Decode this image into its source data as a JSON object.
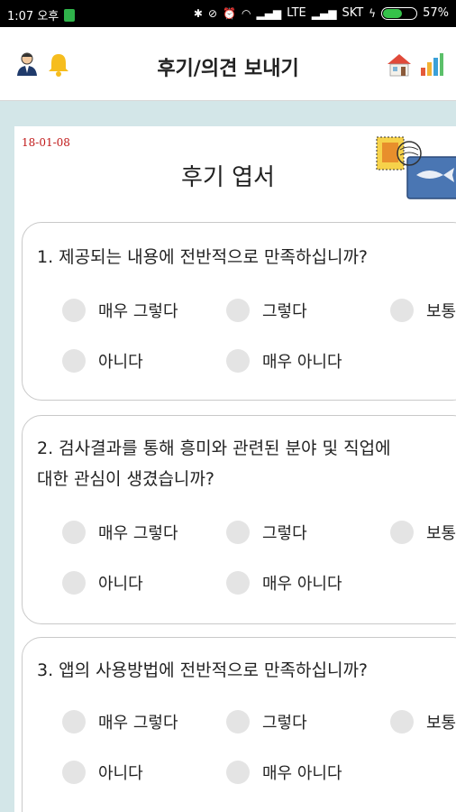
{
  "statusbar": {
    "time": "1:07 오후",
    "network": "LTE",
    "carrier": "SKT",
    "battery": "57%",
    "battery_level": 0.57
  },
  "header": {
    "title": "후기/의견 보내기",
    "icons": [
      "user-icon",
      "bell-icon",
      "home-icon",
      "chart-icon"
    ]
  },
  "card": {
    "date": "18-01-08",
    "title": "후기 엽서"
  },
  "questions": [
    {
      "text_lines": [
        "1. 제공되는 내용에 전반적으로 만족하십니까?"
      ],
      "options": [
        "매우 그렇다",
        "그렇다",
        "보통",
        "아니다",
        "매우 아니다"
      ]
    },
    {
      "text_lines": [
        "2. 검사결과를 통해 흥미와 관련된 분야 및 직업에",
        "대한 관심이 생겼습니까?"
      ],
      "options": [
        "매우 그렇다",
        "그렇다",
        "보통",
        "아니다",
        "매우 아니다"
      ]
    },
    {
      "text_lines": [
        "3. 앱의 사용방법에 전반적으로 만족하십니까?"
      ],
      "options": [
        "매우 그렇다",
        "그렇다",
        "보통",
        "아니다",
        "매우 아니다"
      ]
    }
  ],
  "colors": {
    "content_bg": "#d3e6e8",
    "date_red": "#c01818",
    "radio_gray": "#e4e4e4"
  }
}
